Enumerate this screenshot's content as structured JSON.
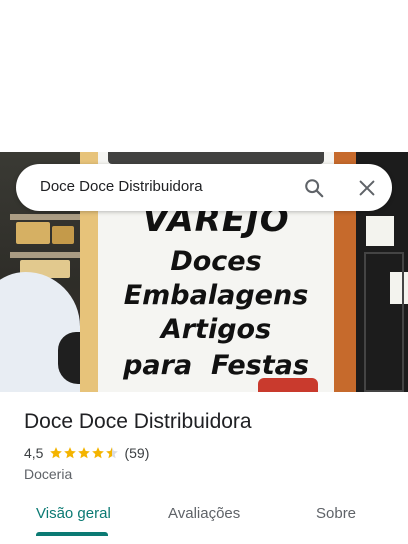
{
  "search": {
    "query": "Doce Doce Distribuidora"
  },
  "place": {
    "name": "Doce Doce Distribuidora",
    "rating": "4,5",
    "reviews": "(59)",
    "category": "Doceria"
  },
  "photo": {
    "sign_lines": [
      "VAREJO",
      "Doces",
      "Embalagens",
      "Artigos",
      "para  Festas"
    ]
  },
  "tabs": [
    {
      "label": "Visão geral",
      "active": true
    },
    {
      "label": "Avaliações",
      "active": false
    },
    {
      "label": "Sobre",
      "active": false
    }
  ],
  "colors": {
    "accent": "#0b7a73",
    "star": "#f4b400"
  },
  "icons": [
    "search-icon",
    "close-icon",
    "star-icon"
  ]
}
